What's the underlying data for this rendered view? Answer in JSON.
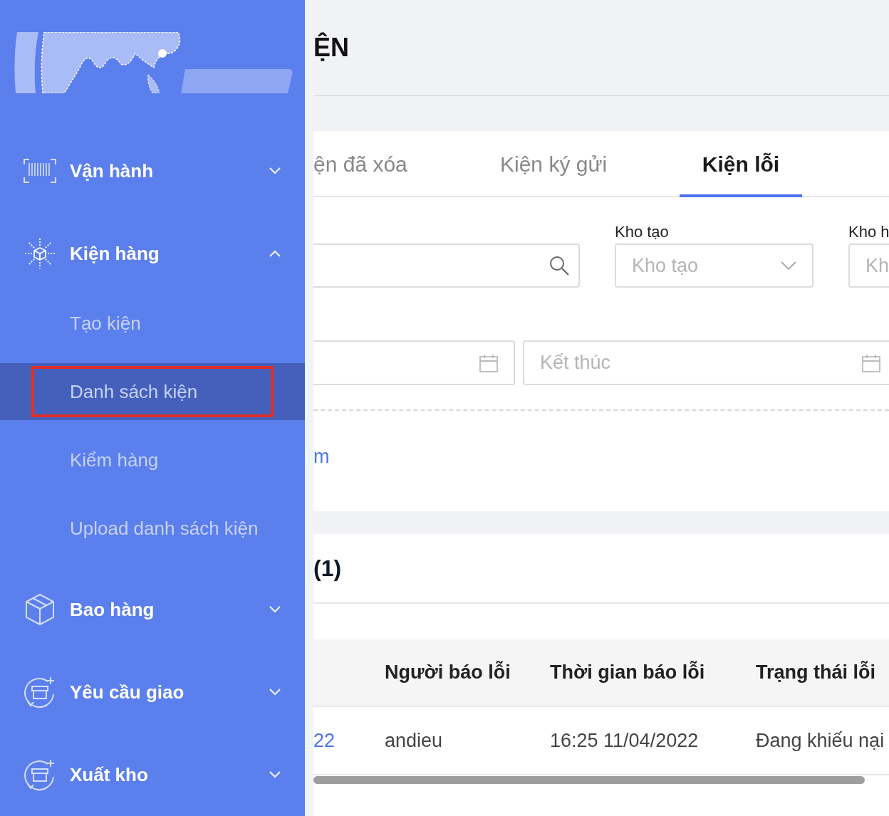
{
  "sidebar": {
    "items": [
      {
        "label": "Vận hành",
        "expanded": false
      },
      {
        "label": "Kiện hàng",
        "expanded": true,
        "children": [
          {
            "label": "Tạo kiện",
            "selected": false,
            "highlighted": false
          },
          {
            "label": "Danh sách kiện",
            "selected": true,
            "highlighted": true
          },
          {
            "label": "Kiểm hàng",
            "selected": false,
            "highlighted": false
          },
          {
            "label": "Upload danh sách kiện",
            "selected": false,
            "highlighted": false
          }
        ]
      },
      {
        "label": "Bao hàng",
        "expanded": false
      },
      {
        "label": "Yêu cầu giao",
        "expanded": false
      },
      {
        "label": "Xuất kho",
        "expanded": false
      }
    ]
  },
  "page_title": "ỆN",
  "tabs": [
    {
      "label": "ện đã xóa",
      "selected": false
    },
    {
      "label": "Kiện ký gửi",
      "selected": false
    },
    {
      "label": "Kiện lỗi",
      "selected": true
    }
  ],
  "filters": {
    "warehouse_label": "Kho tạo",
    "warehouse_select": {
      "placeholder": "Kho tạo"
    },
    "label_3": "Kho h",
    "select_3": {
      "placeholder": "Kh"
    },
    "date_end": {
      "placeholder": "Kết thúc"
    }
  },
  "link": "m",
  "results_title": "(1)",
  "table": {
    "columns": [
      "",
      "Người báo lỗi",
      "Thời gian báo lỗi",
      "Trạng thái lỗi"
    ],
    "rows": [
      {
        "cells": [
          "22",
          "andieu",
          "16:25 11/04/2022",
          "Đang khiếu nại"
        ]
      }
    ]
  }
}
